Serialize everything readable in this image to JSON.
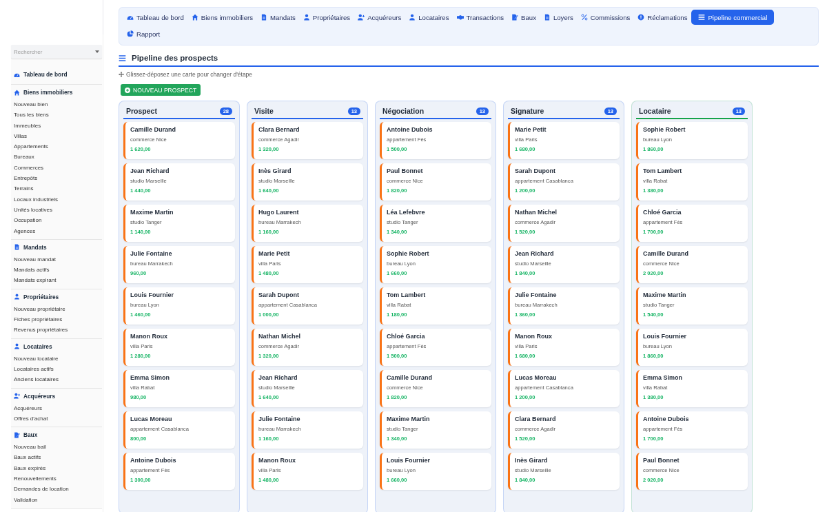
{
  "sidebar": {
    "search": {
      "placeholder": "Rechercher"
    },
    "sections": [
      {
        "title": "Tableau de bord"
      },
      {
        "title": "Biens immobiliers",
        "items": [
          "Nouveau bien",
          "Tous les biens",
          "Immeubles",
          "Villas",
          "Appartements",
          "Bureaux",
          "Commerces",
          "Entrepôts",
          "Terrains",
          "Locaux industriels",
          "Unités locatives",
          "Occupation",
          "Agences"
        ]
      },
      {
        "title": "Mandats",
        "items": [
          "Nouveau mandat",
          "Mandats actifs",
          "Mandats expirant"
        ]
      },
      {
        "title": "Propriétaires",
        "items": [
          "Nouveau propriétaire",
          "Fiches propriétaires",
          "Revenus propriétaires"
        ]
      },
      {
        "title": "Locataires",
        "items": [
          "Nouveau locataire",
          "Locataires actifs",
          "Anciens locataires"
        ]
      },
      {
        "title": "Acquéreurs",
        "items": [
          "Acquéreurs",
          "Offres d'achat"
        ]
      },
      {
        "title": "Baux",
        "items": [
          "Nouveau bail",
          "Baux actifs",
          "Baux expirés",
          "Renouvellements",
          "Demandes de location",
          "Validation"
        ]
      }
    ]
  },
  "tabs": [
    {
      "label": "Tableau de bord",
      "selected": false
    },
    {
      "label": "Biens immobiliers",
      "selected": false
    },
    {
      "label": "Mandats",
      "selected": false
    },
    {
      "label": "Propriétaires",
      "selected": false
    },
    {
      "label": "Acquéreurs",
      "selected": false
    },
    {
      "label": "Locataires",
      "selected": false
    },
    {
      "label": "Transactions",
      "selected": false
    },
    {
      "label": "Baux",
      "selected": false
    },
    {
      "label": "Loyers",
      "selected": false
    },
    {
      "label": "Commissions",
      "selected": false
    },
    {
      "label": "Réclamations",
      "selected": false
    },
    {
      "label": "Pipeline commercial",
      "selected": true
    },
    {
      "label": "Rapport",
      "selected": false
    }
  ],
  "page": {
    "title": "Pipeline des prospects",
    "hint": "Glissez-déposez une carte pour changer d'étape",
    "new_button": "NOUVEAU PROSPECT"
  },
  "columns": [
    {
      "title": "Prospect",
      "count": "28",
      "color": "#2563eb",
      "cards": [
        {
          "name": "Camille Durand",
          "property": "commerce Nice",
          "amount": "1 620,00"
        },
        {
          "name": "Jean Richard",
          "property": "studio Marseille",
          "amount": "1 440,00"
        },
        {
          "name": "Maxime Martin",
          "property": "studio Tanger",
          "amount": "1 140,00"
        },
        {
          "name": "Julie Fontaine",
          "property": "bureau Marrakech",
          "amount": "960,00"
        },
        {
          "name": "Louis Fournier",
          "property": "bureau Lyon",
          "amount": "1 460,00"
        },
        {
          "name": "Manon Roux",
          "property": "villa Paris",
          "amount": "1 280,00"
        },
        {
          "name": "Emma Simon",
          "property": "villa Rabat",
          "amount": "980,00"
        },
        {
          "name": "Lucas Moreau",
          "property": "appartement Casablanca",
          "amount": "800,00"
        },
        {
          "name": "Antoine Dubois",
          "property": "appartement Fès",
          "amount": "1 300,00"
        }
      ]
    },
    {
      "title": "Visite",
      "count": "13",
      "color": "#2563eb",
      "cards": [
        {
          "name": "Clara Bernard",
          "property": "commerce Agadir",
          "amount": "1 320,00"
        },
        {
          "name": "Inès Girard",
          "property": "studio Marseille",
          "amount": "1 640,00"
        },
        {
          "name": "Hugo Laurent",
          "property": "bureau Marrakech",
          "amount": "1 160,00"
        },
        {
          "name": "Marie Petit",
          "property": "villa Paris",
          "amount": "1 480,00"
        },
        {
          "name": "Sarah Dupont",
          "property": "appartement Casablanca",
          "amount": "1 000,00"
        },
        {
          "name": "Nathan Michel",
          "property": "commerce Agadir",
          "amount": "1 320,00"
        },
        {
          "name": "Jean Richard",
          "property": "studio Marseille",
          "amount": "1 640,00"
        },
        {
          "name": "Julie Fontaine",
          "property": "bureau Marrakech",
          "amount": "1 160,00"
        },
        {
          "name": "Manon Roux",
          "property": "villa Paris",
          "amount": "1 480,00"
        }
      ]
    },
    {
      "title": "Négociation",
      "count": "13",
      "color": "#2563eb",
      "cards": [
        {
          "name": "Antoine Dubois",
          "property": "appartement Fès",
          "amount": "1 500,00"
        },
        {
          "name": "Paul Bonnet",
          "property": "commerce Nice",
          "amount": "1 820,00"
        },
        {
          "name": "Léa Lefebvre",
          "property": "studio Tanger",
          "amount": "1 340,00"
        },
        {
          "name": "Sophie Robert",
          "property": "bureau Lyon",
          "amount": "1 660,00"
        },
        {
          "name": "Tom Lambert",
          "property": "villa Rabat",
          "amount": "1 180,00"
        },
        {
          "name": "Chloé Garcia",
          "property": "appartement Fès",
          "amount": "1 500,00"
        },
        {
          "name": "Camille Durand",
          "property": "commerce Nice",
          "amount": "1 820,00"
        },
        {
          "name": "Maxime Martin",
          "property": "studio Tanger",
          "amount": "1 340,00"
        },
        {
          "name": "Louis Fournier",
          "property": "bureau Lyon",
          "amount": "1 660,00"
        }
      ]
    },
    {
      "title": "Signature",
      "count": "13",
      "color": "#2563eb",
      "cards": [
        {
          "name": "Marie Petit",
          "property": "villa Paris",
          "amount": "1 680,00"
        },
        {
          "name": "Sarah Dupont",
          "property": "appartement Casablanca",
          "amount": "1 200,00"
        },
        {
          "name": "Nathan Michel",
          "property": "commerce Agadir",
          "amount": "1 520,00"
        },
        {
          "name": "Jean Richard",
          "property": "studio Marseille",
          "amount": "1 840,00"
        },
        {
          "name": "Julie Fontaine",
          "property": "bureau Marrakech",
          "amount": "1 360,00"
        },
        {
          "name": "Manon Roux",
          "property": "villa Paris",
          "amount": "1 680,00"
        },
        {
          "name": "Lucas Moreau",
          "property": "appartement Casablanca",
          "amount": "1 200,00"
        },
        {
          "name": "Clara Bernard",
          "property": "commerce Agadir",
          "amount": "1 520,00"
        },
        {
          "name": "Inès Girard",
          "property": "studio Marseille",
          "amount": "1 840,00"
        }
      ]
    },
    {
      "title": "Locataire",
      "count": "13",
      "color": "#16a34a",
      "cards": [
        {
          "name": "Sophie Robert",
          "property": "bureau Lyon",
          "amount": "1 860,00"
        },
        {
          "name": "Tom Lambert",
          "property": "villa Rabat",
          "amount": "1 380,00"
        },
        {
          "name": "Chloé Garcia",
          "property": "appartement Fès",
          "amount": "1 700,00"
        },
        {
          "name": "Camille Durand",
          "property": "commerce Nice",
          "amount": "2 020,00"
        },
        {
          "name": "Maxime Martin",
          "property": "studio Tanger",
          "amount": "1 540,00"
        },
        {
          "name": "Louis Fournier",
          "property": "bureau Lyon",
          "amount": "1 860,00"
        },
        {
          "name": "Emma Simon",
          "property": "villa Rabat",
          "amount": "1 380,00"
        },
        {
          "name": "Antoine Dubois",
          "property": "appartement Fès",
          "amount": "1 700,00"
        },
        {
          "name": "Paul Bonnet",
          "property": "commerce Nice",
          "amount": "2 020,00"
        }
      ]
    }
  ]
}
